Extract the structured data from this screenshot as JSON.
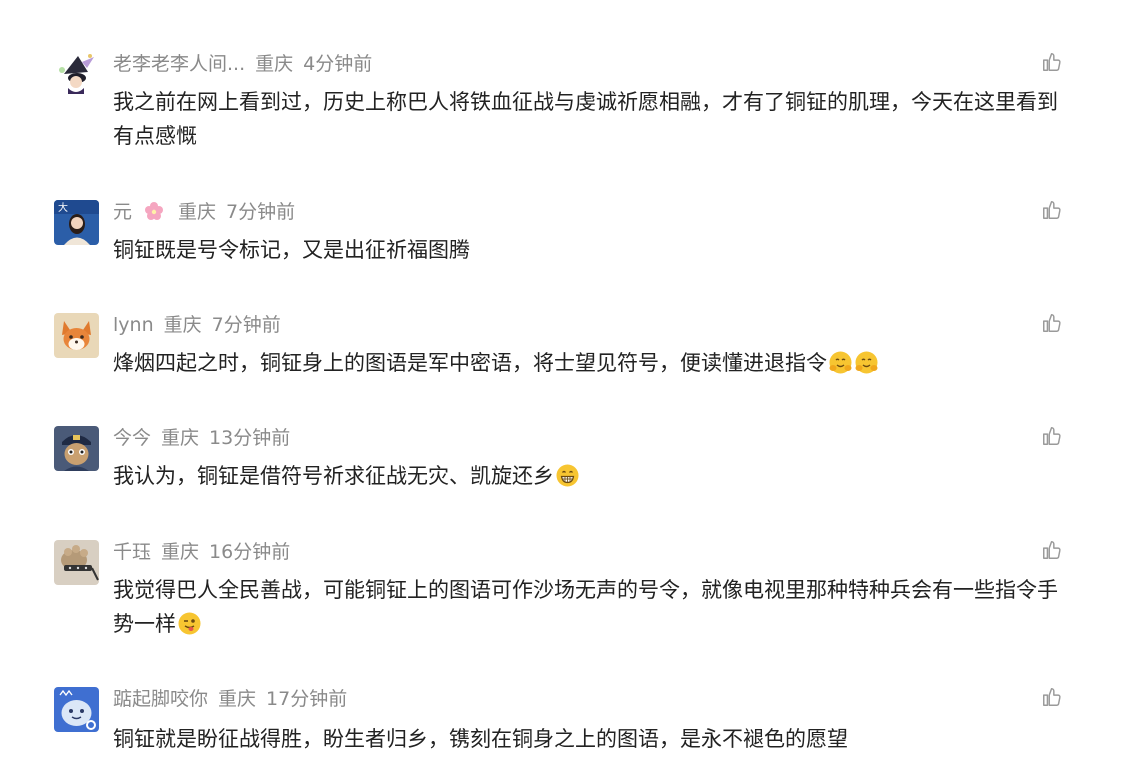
{
  "comments": [
    {
      "user": "老李老李人间...",
      "location": "重庆",
      "time": "4分钟前",
      "text": "我之前在网上看到过，历史上称巴人将铁血征战与虔诚祈愿相融，才有了铜钲的肌理，今天在这里看到有点感慨",
      "avatar": "witch-avatar",
      "emoji": []
    },
    {
      "user": "元",
      "user_icon": "cherry-blossom-icon",
      "location": "重庆",
      "time": "7分钟前",
      "text": "铜钲既是号令标记，又是出征祈福图腾",
      "avatar": "news-anchor-avatar",
      "emoji": []
    },
    {
      "user": "lynn",
      "location": "重庆",
      "time": "7分钟前",
      "text": "烽烟四起之时，铜钲身上的图语是军中密语，将士望见符号，便读懂进退指令",
      "avatar": "fox-avatar",
      "emoji": [
        "hugging-face-emoji",
        "hugging-face-emoji"
      ]
    },
    {
      "user": "今今",
      "location": "重庆",
      "time": "13分钟前",
      "text": "我认为，铜钲是借符号祈求征战无灾、凯旋还乡",
      "avatar": "police-cartoon-avatar",
      "emoji": [
        "grinning-face-emoji"
      ]
    },
    {
      "user": "千珏",
      "location": "重庆",
      "time": "16分钟前",
      "text": "我觉得巴人全民善战，可能铜钲上的图语可作沙场无声的号令，就像电视里那种特种兵会有一些指令手势一样",
      "avatar": "cat-paw-avatar",
      "emoji": [
        "wink-tongue-face-emoji"
      ]
    },
    {
      "user": "踮起脚咬你",
      "location": "重庆",
      "time": "17分钟前",
      "text": "铜钲就是盼征战得胜，盼生者归乡，镌刻在铜身之上的图语，是永不褪色的愿望",
      "avatar": "blue-cartoon-avatar",
      "emoji": []
    }
  ],
  "like_icon": "thumbs-up-icon",
  "colors": {
    "meta": "#8a8a8a",
    "text": "#222222",
    "icon": "#9a9a9a"
  }
}
